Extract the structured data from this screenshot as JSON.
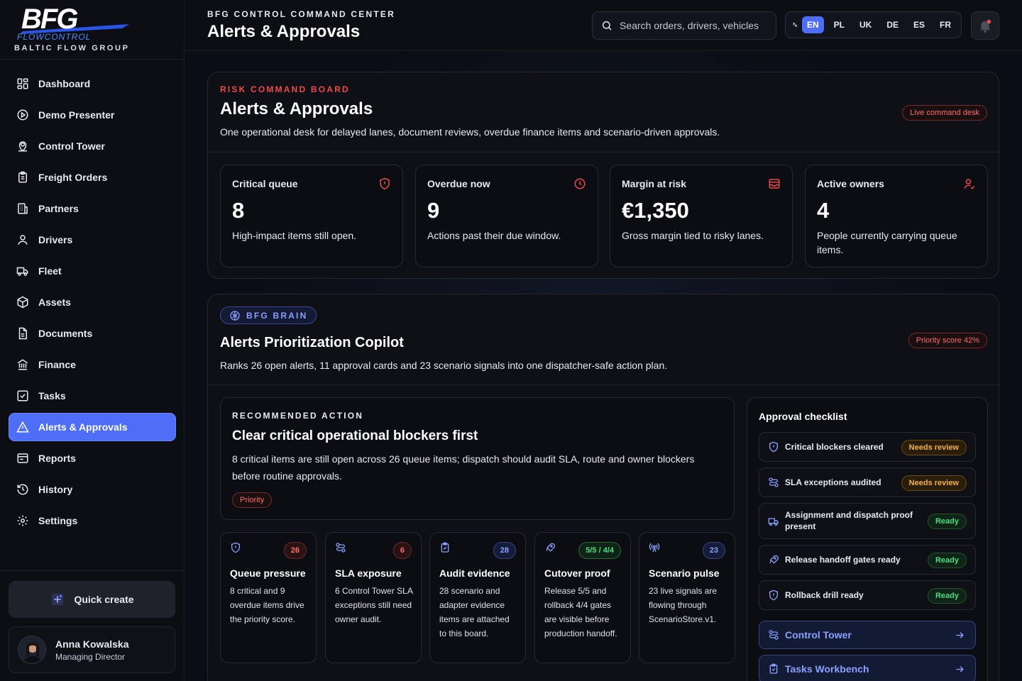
{
  "brand": {
    "logo_text": "BFG",
    "logo_sub": "FLOWCONTROL",
    "tagline": "BALTIC FLOW GROUP"
  },
  "nav": {
    "items": [
      {
        "label": "Dashboard",
        "icon": "grid-icon"
      },
      {
        "label": "Demo Presenter",
        "icon": "play-icon"
      },
      {
        "label": "Control Tower",
        "icon": "map-pin-icon"
      },
      {
        "label": "Freight Orders",
        "icon": "clipboard-icon"
      },
      {
        "label": "Partners",
        "icon": "building-icon"
      },
      {
        "label": "Drivers",
        "icon": "user-icon"
      },
      {
        "label": "Fleet",
        "icon": "truck-icon"
      },
      {
        "label": "Assets",
        "icon": "package-icon"
      },
      {
        "label": "Documents",
        "icon": "file-icon"
      },
      {
        "label": "Finance",
        "icon": "bank-icon"
      },
      {
        "label": "Tasks",
        "icon": "checkbox-icon"
      },
      {
        "label": "Alerts & Approvals",
        "icon": "warning-icon",
        "active": true
      },
      {
        "label": "Reports",
        "icon": "report-icon"
      },
      {
        "label": "History",
        "icon": "history-icon"
      },
      {
        "label": "Settings",
        "icon": "gear-icon"
      }
    ]
  },
  "quick_create": {
    "label": "Quick create"
  },
  "user": {
    "name": "Anna Kowalska",
    "role": "Managing Director"
  },
  "header": {
    "eyebrow": "BFG CONTROL COMMAND CENTER",
    "title": "Alerts & Approvals",
    "search_placeholder": "Search orders, drivers, vehicles",
    "languages": [
      "EN",
      "PL",
      "UK",
      "DE",
      "ES",
      "FR"
    ],
    "active_language": "EN"
  },
  "risk_board": {
    "kicker": "RISK COMMAND BOARD",
    "title": "Alerts & Approvals",
    "description": "One operational desk for delayed lanes, document reviews, overdue finance items and scenario-driven approvals.",
    "pill": "Live command desk",
    "kpis": [
      {
        "label": "Critical queue",
        "value": "8",
        "desc": "High-impact items still open.",
        "icon": "shield-alert-icon"
      },
      {
        "label": "Overdue now",
        "value": "9",
        "desc": "Actions past their due window.",
        "icon": "clock-icon"
      },
      {
        "label": "Margin at risk",
        "value": "€1,350",
        "desc": "Gross margin tied to risky lanes.",
        "icon": "inbox-icon"
      },
      {
        "label": "Active owners",
        "value": "4",
        "desc": "People currently carrying queue items.",
        "icon": "user-check-icon"
      }
    ]
  },
  "copilot": {
    "badge": "BFG BRAIN",
    "title": "Alerts Prioritization Copilot",
    "description": "Ranks 26 open alerts, 11 approval cards and 23 scenario signals into one dispatcher-safe action plan.",
    "pill": "Priority score 42%",
    "recommended": {
      "kicker": "RECOMMENDED ACTION",
      "title": "Clear critical operational blockers first",
      "description": "8 critical items are still open across 26 queue items; dispatch should audit SLA, route and owner blockers before routine approvals.",
      "tag": "Priority"
    },
    "cards": [
      {
        "title": "Queue pressure",
        "badge": "26",
        "tone": "red",
        "icon": "shield-icon",
        "desc": "8 critical and 9 overdue items drive the priority score."
      },
      {
        "title": "SLA exposure",
        "badge": "6",
        "tone": "red",
        "icon": "route-icon",
        "desc": "6 Control Tower SLA exceptions still need owner audit."
      },
      {
        "title": "Audit evidence",
        "badge": "28",
        "tone": "blue",
        "icon": "clipboard-check-icon",
        "desc": "28 scenario and adapter evidence items are attached to this board."
      },
      {
        "title": "Cutover proof",
        "badge": "5/5 / 4/4",
        "tone": "green",
        "icon": "rocket-icon",
        "desc": "Release 5/5 and rollback 4/4 gates are visible before production handoff."
      },
      {
        "title": "Scenario pulse",
        "badge": "23",
        "tone": "blue",
        "icon": "broadcast-icon",
        "desc": "23 live signals are flowing through ScenarioStore.v1."
      }
    ],
    "checklist": {
      "title": "Approval checklist",
      "items": [
        {
          "label": "Critical blockers cleared",
          "status": "Needs review",
          "tone": "amber",
          "icon": "shield-icon"
        },
        {
          "label": "SLA exceptions audited",
          "status": "Needs review",
          "tone": "amber",
          "icon": "route-icon"
        },
        {
          "label": "Assignment and dispatch proof present",
          "status": "Ready",
          "tone": "green",
          "icon": "truck-icon"
        },
        {
          "label": "Release handoff gates ready",
          "status": "Ready",
          "tone": "green",
          "icon": "rocket-icon"
        },
        {
          "label": "Rollback drill ready",
          "status": "Ready",
          "tone": "green",
          "icon": "shield-icon"
        }
      ],
      "links": [
        {
          "label": "Control Tower",
          "icon": "route-icon"
        },
        {
          "label": "Tasks Workbench",
          "icon": "clipboard-check-icon"
        }
      ]
    }
  },
  "colors": {
    "accent": "#4f6ef7",
    "danger": "#ef4a4a",
    "warning": "#f5b042",
    "success": "#4ade80"
  }
}
